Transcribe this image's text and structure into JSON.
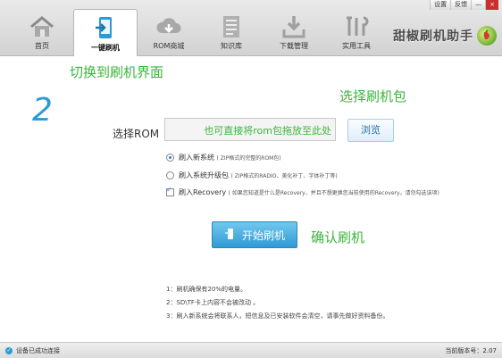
{
  "window": {
    "buttons": [
      "设置",
      "反馈",
      "—",
      "×"
    ]
  },
  "nav": {
    "tabs": [
      {
        "label": "首页",
        "icon": "home-icon"
      },
      {
        "label": "一键刷机",
        "icon": "flash-phone-icon",
        "active": true
      },
      {
        "label": "ROM商城",
        "icon": "cloud-download-icon"
      },
      {
        "label": "知识库",
        "icon": "document-icon"
      },
      {
        "label": "下载管理",
        "icon": "download-tray-icon"
      },
      {
        "label": "实用工具",
        "icon": "tools-icon"
      }
    ]
  },
  "brand": {
    "text": "甜椒刷机助手"
  },
  "annotations": {
    "switch_text": "切换到刷机界面",
    "step_number": "2",
    "select_text": "选择刷机包",
    "confirm_text": "确认刷机"
  },
  "rom": {
    "label": "选择ROM",
    "placeholder": "也可直接将rom包拖放至此处",
    "browse_label": "浏览"
  },
  "options": [
    {
      "type": "radio",
      "checked": true,
      "label": "刷入新系统",
      "desc": "( ZIP格式的完整的ROM包)"
    },
    {
      "type": "radio",
      "checked": false,
      "label": "刷入系统升级包",
      "desc": "( ZIP格式的RADIO、美化补丁、字体补丁等)"
    },
    {
      "type": "checkbox",
      "checked": true,
      "label": "刷入Recovery",
      "desc": "( 如果您知道是什么是Recovery，并且不想更换您当前使用的Recovery，请勿勾选该项)"
    }
  ],
  "start_button": {
    "label": "开始刷机"
  },
  "notes": [
    "1：刷机确保有20%的电量。",
    "2：SD\\TF卡上内容不会被改动 。",
    "3：刷入新系统会将联系人，短信息及已安装软件会清空，请事先做好资料备份。"
  ],
  "status": {
    "connection": "设备已成功连接",
    "version": "当前版本号：2.07"
  },
  "colors": {
    "accent_blue": "#2a9bd6",
    "annotation_green": "#3cb43c"
  }
}
